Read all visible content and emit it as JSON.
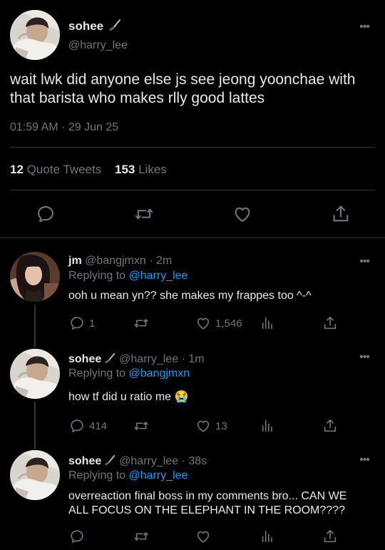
{
  "main_tweet": {
    "display_name": "sohee",
    "handle": "@harry_lee",
    "text": "wait lwk did anyone else js see jeong yoonchae with that barista who makes rlly good lattes",
    "timestamp": "01:59 AM · 29 Jun 25",
    "quote_tweets_count": "12",
    "quote_tweets_label": "Quote Tweets",
    "likes_count": "153",
    "likes_label": "Likes"
  },
  "more_glyph": "•••",
  "replies": [
    {
      "display_name": "jm",
      "handle": "@bangjmxn",
      "time": "· 2m",
      "replying_prefix": "Replying to",
      "replying_to": "@harry_lee",
      "text": "ooh u mean yn?? she makes my frappes too ^-^",
      "reply_count": "1",
      "retweet_count": "",
      "like_count": "1,546"
    },
    {
      "display_name": "sohee",
      "handle": "@harry_lee",
      "time": "· 1m",
      "replying_prefix": "Replying to",
      "replying_to": "@bangjmxn",
      "text": "how tf did u ratio me 😭",
      "reply_count": "414",
      "retweet_count": "",
      "like_count": "13"
    },
    {
      "display_name": "sohee",
      "handle": "@harry_lee",
      "time": "· 38s",
      "replying_prefix": "Replying to",
      "replying_to": "@harry_lee",
      "text": "overreaction final boss in my comments bro... CAN WE ALL FOCUS ON THE ELEPHANT IN THE ROOM????",
      "reply_count": "",
      "retweet_count": "",
      "like_count": ""
    }
  ],
  "colors": {
    "background": "#000000",
    "text": "#e7e9ea",
    "muted": "#71767b",
    "link": "#1d9bf0",
    "divider": "#2f3336"
  },
  "icons": [
    "reply-icon",
    "retweet-icon",
    "like-icon",
    "share-icon",
    "views-icon",
    "more-icon",
    "hockey-stick-icon"
  ]
}
